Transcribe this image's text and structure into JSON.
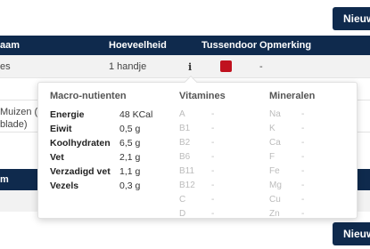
{
  "buttons": {
    "new_top": "Nieuw",
    "new_bottom": "Nieuw"
  },
  "table": {
    "headers": {
      "name": "aam",
      "amount": "Hoeveelheid",
      "snack": "Tussendoor",
      "note": "Opmerking"
    },
    "row1": {
      "name": "es",
      "amount": "1 handje",
      "note": "-",
      "snack_color": "#c0121f"
    },
    "other_rows": [
      "Muizen (su",
      "blade)"
    ]
  },
  "section2": {
    "title": "m"
  },
  "popup": {
    "macro_title": "Macro-nutienten",
    "vitamins_title": "Vitamines",
    "minerals_title": "Mineralen",
    "macros": [
      {
        "label": "Energie",
        "value": "48 KCal"
      },
      {
        "label": "Eiwit",
        "value": "0,5 g"
      },
      {
        "label": "Koolhydraten",
        "value": "6,5 g"
      },
      {
        "label": "Vet",
        "value": "2,1 g"
      },
      {
        "label": "Verzadigd vet",
        "value": "1,1 g"
      },
      {
        "label": "Vezels",
        "value": "0,3 g"
      }
    ],
    "vitamins": [
      {
        "name": "A",
        "value": "-"
      },
      {
        "name": "B1",
        "value": "-"
      },
      {
        "name": "B2",
        "value": "-"
      },
      {
        "name": "B6",
        "value": "-"
      },
      {
        "name": "B11",
        "value": "-"
      },
      {
        "name": "B12",
        "value": "-"
      },
      {
        "name": "C",
        "value": "-"
      },
      {
        "name": "D",
        "value": "-"
      }
    ],
    "minerals": [
      {
        "name": "Na",
        "value": "-"
      },
      {
        "name": "K",
        "value": "-"
      },
      {
        "name": "Ca",
        "value": "-"
      },
      {
        "name": "F",
        "value": "-"
      },
      {
        "name": "Fe",
        "value": "-"
      },
      {
        "name": "Mg",
        "value": "-"
      },
      {
        "name": "Cu",
        "value": "-"
      },
      {
        "name": "Zn",
        "value": "-"
      }
    ]
  },
  "icons": {
    "info": "info-icon"
  }
}
